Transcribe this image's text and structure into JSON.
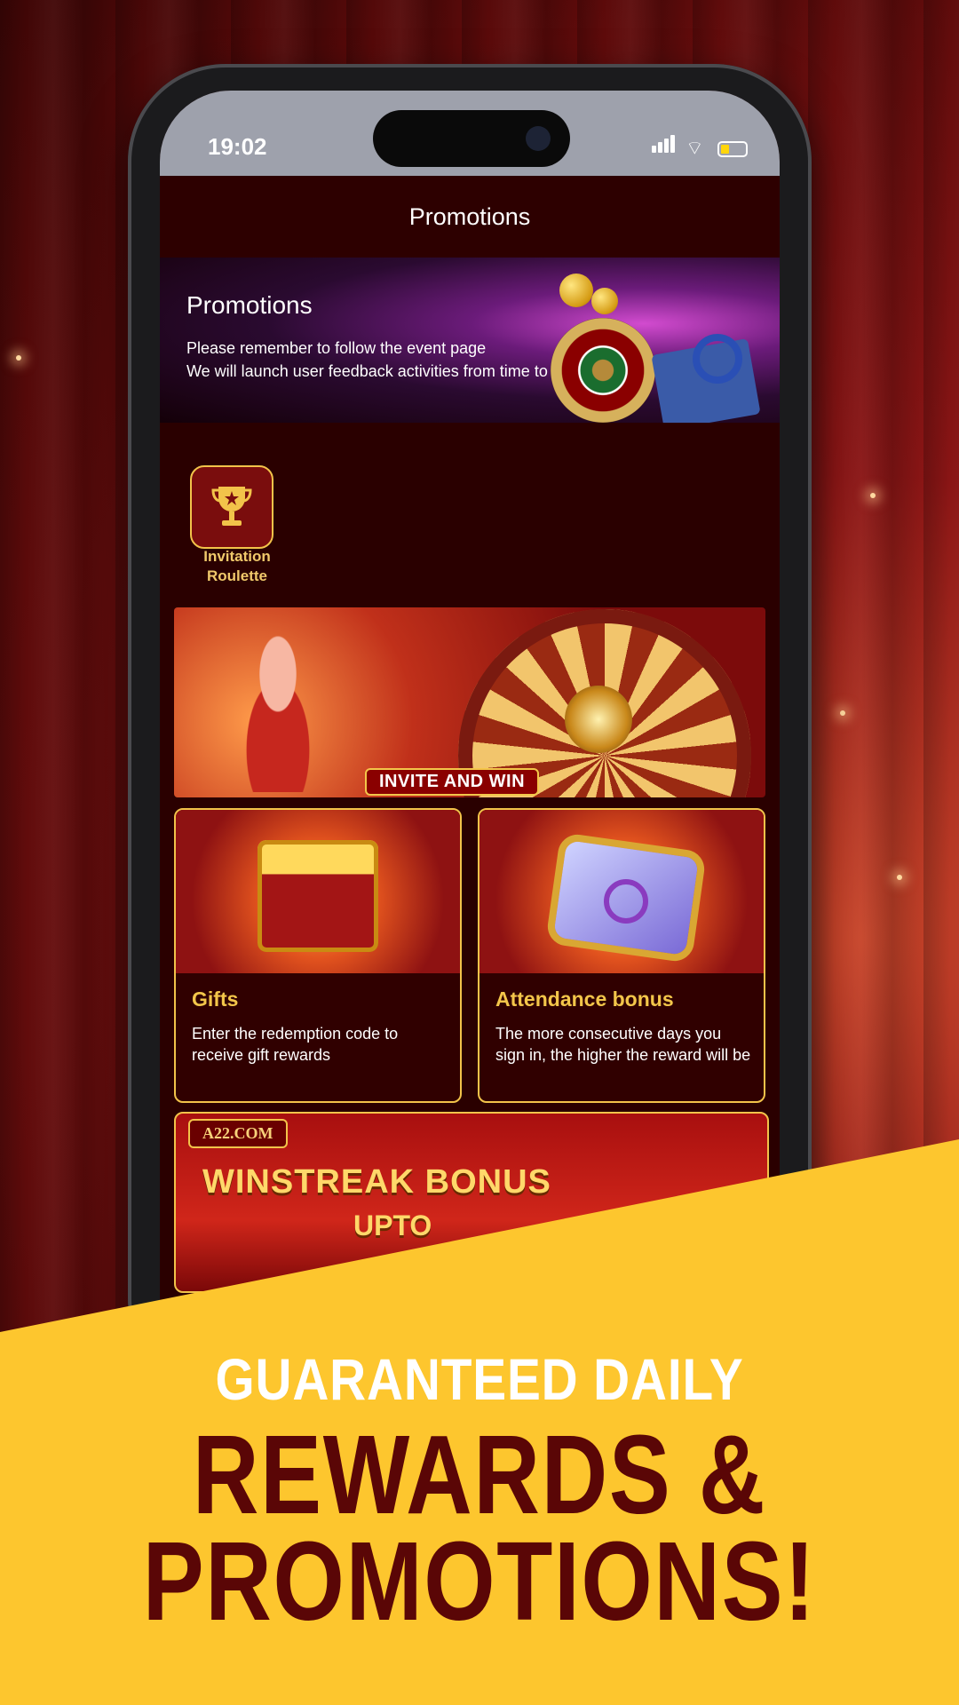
{
  "status_bar": {
    "time": "19:02"
  },
  "header": {
    "title": "Promotions"
  },
  "hero": {
    "title": "Promotions",
    "line1": "Please remember to follow the event page",
    "line2": "We will launch user feedback activities from time to time"
  },
  "quick_link": {
    "label_line1": "Invitation",
    "label_line2": "Roulette",
    "icon": "trophy-icon"
  },
  "invite_banner": {
    "cta": "INVITE AND WIN"
  },
  "cards": [
    {
      "title": "Gifts",
      "description": "Enter the redemption code to receive gift rewards"
    },
    {
      "title": "Attendance bonus",
      "description": "The more consecutive days you sign in, the higher the reward will be"
    }
  ],
  "winstreak": {
    "logo": "A22.COM",
    "title": "WINSTREAK BONUS",
    "upto": "UPTO"
  },
  "promo": {
    "subtitle": "GUARANTEED DAILY",
    "line1": "REWARDS &",
    "line2": "PROMOTIONS!"
  },
  "colors": {
    "accent_gold": "#f2c34a",
    "banner_yellow": "#fdc62e",
    "dark_maroon": "#5a0606"
  }
}
